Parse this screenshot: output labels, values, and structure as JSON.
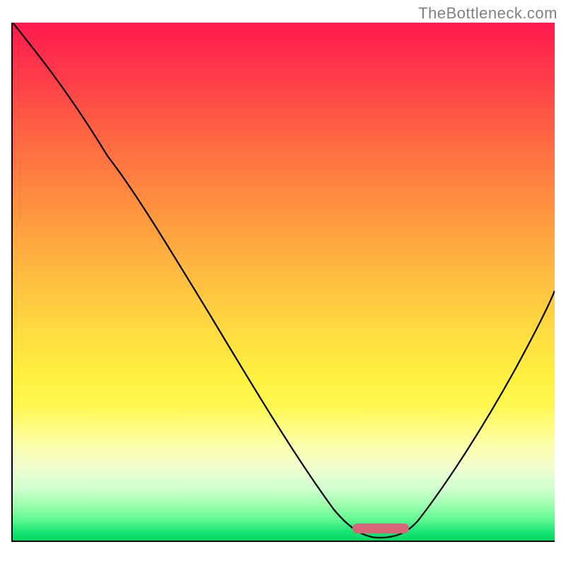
{
  "watermark": "TheBottleneck.com",
  "chart_data": {
    "type": "line",
    "title": "",
    "xlabel": "",
    "ylabel": "",
    "xlim": [
      0,
      100
    ],
    "ylim": [
      0,
      100
    ],
    "series": [
      {
        "name": "curve",
        "x": [
          0,
          12,
          24,
          40,
          55,
          62,
          66,
          70,
          74,
          80,
          88,
          96,
          100
        ],
        "values": [
          100,
          87,
          72,
          47,
          22,
          9,
          3,
          0.5,
          0.5,
          4,
          16,
          33,
          43
        ]
      }
    ],
    "marker": {
      "x_start": 63,
      "x_end": 73,
      "y": 2,
      "label": "optimal-range"
    },
    "gradient_stops": [
      {
        "pos": 0,
        "color": "#ff1a4d"
      },
      {
        "pos": 50,
        "color": "#ffc040"
      },
      {
        "pos": 80,
        "color": "#fffc80"
      },
      {
        "pos": 100,
        "color": "#00d860"
      }
    ]
  }
}
